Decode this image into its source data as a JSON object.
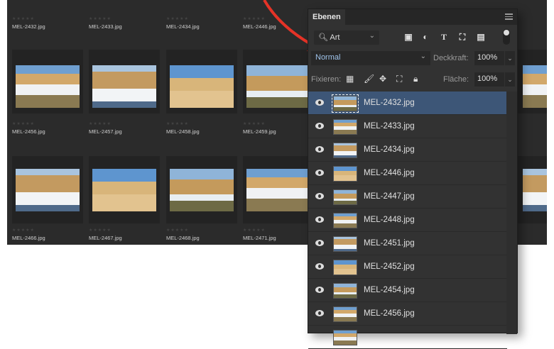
{
  "gallery": {
    "rows": [
      {
        "items": [
          {
            "name": "MEL-2432.jpg"
          },
          {
            "name": "MEL-2433.jpg"
          },
          {
            "name": "MEL-2434.jpg"
          },
          {
            "name": "MEL-2446.jpg"
          }
        ]
      },
      {
        "items": [
          {
            "name": "MEL-2456.jpg"
          },
          {
            "name": "MEL-2457.jpg"
          },
          {
            "name": "MEL-2458.jpg"
          },
          {
            "name": "MEL-2459.jpg"
          }
        ]
      },
      {
        "items": [
          {
            "name": "MEL-2466.jpg"
          },
          {
            "name": "MEL-2467.jpg"
          },
          {
            "name": "MEL-2468.jpg"
          },
          {
            "name": "MEL-2471.jpg"
          }
        ]
      }
    ],
    "stars": "★★★★★"
  },
  "panel": {
    "tab": "Ebenen",
    "filter": "Art",
    "blend_mode": "Normal",
    "opacity_label": "Deckkraft:",
    "opacity": "100%",
    "lock_label": "Fixieren:",
    "fill_label": "Fläche:",
    "fill": "100%",
    "layers": [
      {
        "name": "MEL-2432.jpg",
        "selected": true
      },
      {
        "name": "MEL-2433.jpg"
      },
      {
        "name": "MEL-2434.jpg"
      },
      {
        "name": "MEL-2446.jpg"
      },
      {
        "name": "MEL-2447.jpg"
      },
      {
        "name": "MEL-2448.jpg"
      },
      {
        "name": "MEL-2451.jpg"
      },
      {
        "name": "MEL-2452.jpg"
      },
      {
        "name": "MEL-2454.jpg"
      },
      {
        "name": "MEL-2456.jpg"
      }
    ]
  },
  "colors": {
    "arrow": "#e53327",
    "selection": "#3d5677"
  }
}
